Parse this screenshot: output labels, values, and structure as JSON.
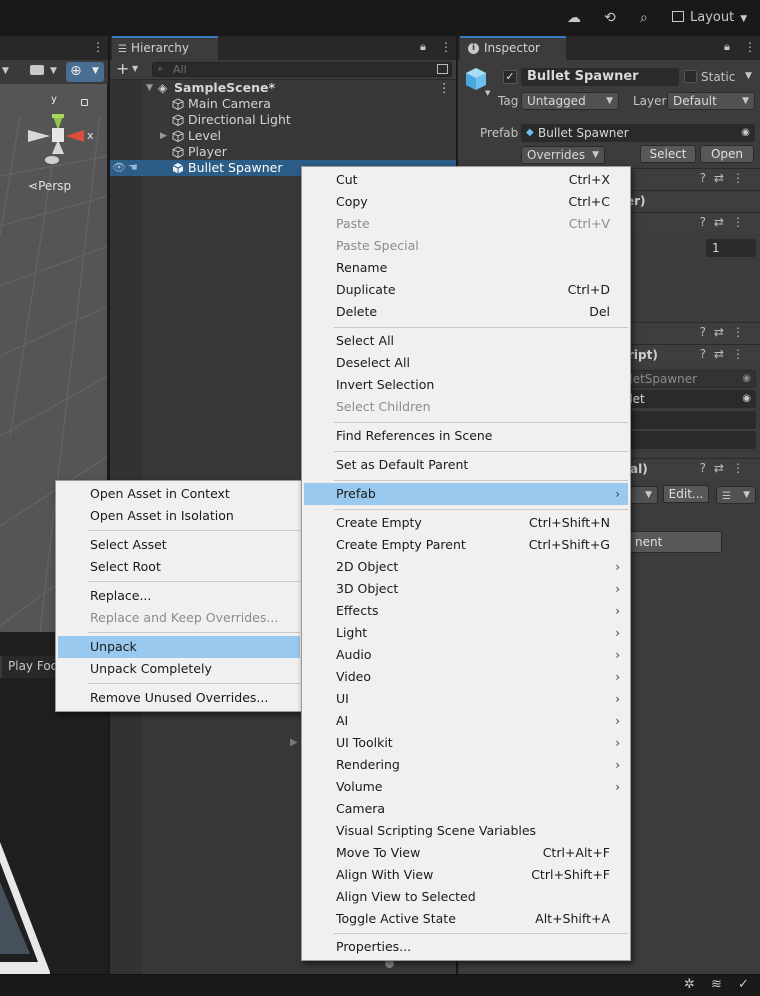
{
  "toolbar": {
    "layout_label": "Layout"
  },
  "scene": {
    "persp_label": "Persp",
    "axis_x": "x",
    "axis_y": "y",
    "play_focus_label": "Play Foc"
  },
  "hierarchy": {
    "tab_label": "Hierarchy",
    "add_label": "+",
    "search_placeholder": "All",
    "rows": [
      {
        "label": "SampleScene*"
      },
      {
        "label": "Main Camera"
      },
      {
        "label": "Directional Light"
      },
      {
        "label": "Level"
      },
      {
        "label": "Player"
      },
      {
        "label": "Bullet Spawner"
      }
    ]
  },
  "inspector": {
    "tab_label": "Inspector",
    "object_name": "Bullet Spawner",
    "static_label": "Static",
    "tag_label": "Tag",
    "tag_value": "Untagged",
    "layer_label": "Layer",
    "layer_value": "Default",
    "prefab_label": "Prefab",
    "prefab_value": "Bullet Spawner",
    "overrides_label": "Overrides",
    "select_label": "Select",
    "open_label": "Open",
    "partial": {
      "comp1": "er)",
      "value1": "1",
      "comp2": "ript)",
      "field_a": "lletSpawner",
      "field_b": "llet",
      "comp3": "al)",
      "edit_label": "Edit...",
      "add_component": "nent"
    }
  },
  "prefab_submenu": {
    "items": [
      {
        "label": "Open Asset in Context",
        "disabled": false
      },
      {
        "label": "Open Asset in Isolation",
        "disabled": false
      },
      {
        "label": "Select Asset",
        "disabled": false
      },
      {
        "label": "Select Root",
        "disabled": false
      },
      {
        "label": "Replace...",
        "disabled": false
      },
      {
        "label": "Replace and Keep Overrides...",
        "disabled": true
      },
      {
        "label": "Unpack",
        "disabled": false,
        "highlighted": true
      },
      {
        "label": "Unpack Completely",
        "disabled": false
      },
      {
        "label": "Remove Unused Overrides...",
        "disabled": false
      }
    ]
  },
  "context_menu": {
    "items": [
      {
        "label": "Cut",
        "shortcut": "Ctrl+X"
      },
      {
        "label": "Copy",
        "shortcut": "Ctrl+C"
      },
      {
        "label": "Paste",
        "shortcut": "Ctrl+V",
        "disabled": true
      },
      {
        "label": "Paste Special",
        "disabled": true
      },
      {
        "label": "Rename"
      },
      {
        "label": "Duplicate",
        "shortcut": "Ctrl+D"
      },
      {
        "label": "Delete",
        "shortcut": "Del"
      },
      {
        "label": "Select All"
      },
      {
        "label": "Deselect All"
      },
      {
        "label": "Invert Selection"
      },
      {
        "label": "Select Children",
        "disabled": true
      },
      {
        "label": "Find References in Scene"
      },
      {
        "label": "Set as Default Parent"
      },
      {
        "label": "Prefab",
        "submenu": true,
        "highlighted": true
      },
      {
        "label": "Create Empty",
        "shortcut": "Ctrl+Shift+N"
      },
      {
        "label": "Create Empty Parent",
        "shortcut": "Ctrl+Shift+G"
      },
      {
        "label": "2D Object",
        "submenu": true
      },
      {
        "label": "3D Object",
        "submenu": true
      },
      {
        "label": "Effects",
        "submenu": true
      },
      {
        "label": "Light",
        "submenu": true
      },
      {
        "label": "Audio",
        "submenu": true
      },
      {
        "label": "Video",
        "submenu": true
      },
      {
        "label": "UI",
        "submenu": true
      },
      {
        "label": "AI",
        "submenu": true
      },
      {
        "label": "UI Toolkit",
        "submenu": true
      },
      {
        "label": "Rendering",
        "submenu": true
      },
      {
        "label": "Volume",
        "submenu": true
      },
      {
        "label": "Camera"
      },
      {
        "label": "Visual Scripting Scene Variables"
      },
      {
        "label": "Move To View",
        "shortcut": "Ctrl+Alt+F"
      },
      {
        "label": "Align With View",
        "shortcut": "Ctrl+Shift+F"
      },
      {
        "label": "Align View to Selected"
      },
      {
        "label": "Toggle Active State",
        "shortcut": "Alt+Shift+A"
      },
      {
        "label": "Properties..."
      }
    ]
  }
}
